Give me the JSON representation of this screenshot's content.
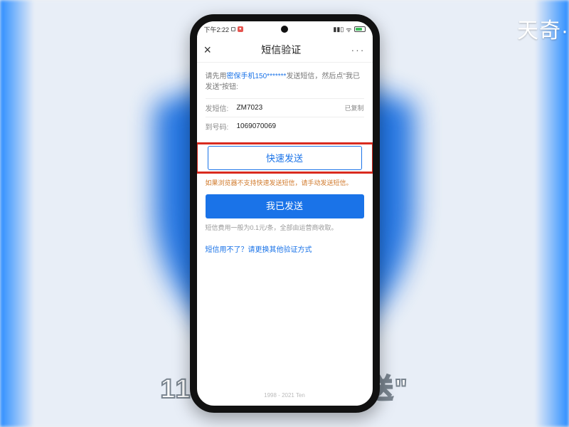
{
  "watermark": "天奇·",
  "caption": "11. 点击\"快速发送\"",
  "statusbar": {
    "time": "下午2:22",
    "battery_pct": "67"
  },
  "titlebar": {
    "title": "短信验证"
  },
  "instruction": {
    "pre": "请先用",
    "highlight": "密保手机150*******",
    "post": "发送短信，然后点\"我已发送\"按钮:"
  },
  "rows": {
    "send_label": "发短信:",
    "send_value": "ZM7023",
    "copied_label": "已复制",
    "to_label": "到号码:",
    "to_value": "1069070069"
  },
  "buttons": {
    "quick_send": "快速发送",
    "quick_send_hint": "如果浏览器不支持快速发送短信，请手动发送短信。",
    "sent": "我已发送",
    "fee_hint": "短信费用一般为0.1元/条，全部由运营商收取。",
    "alt_link": "短信用不了？请更换其他验证方式"
  },
  "footer": "1998 - 2021 Ten"
}
